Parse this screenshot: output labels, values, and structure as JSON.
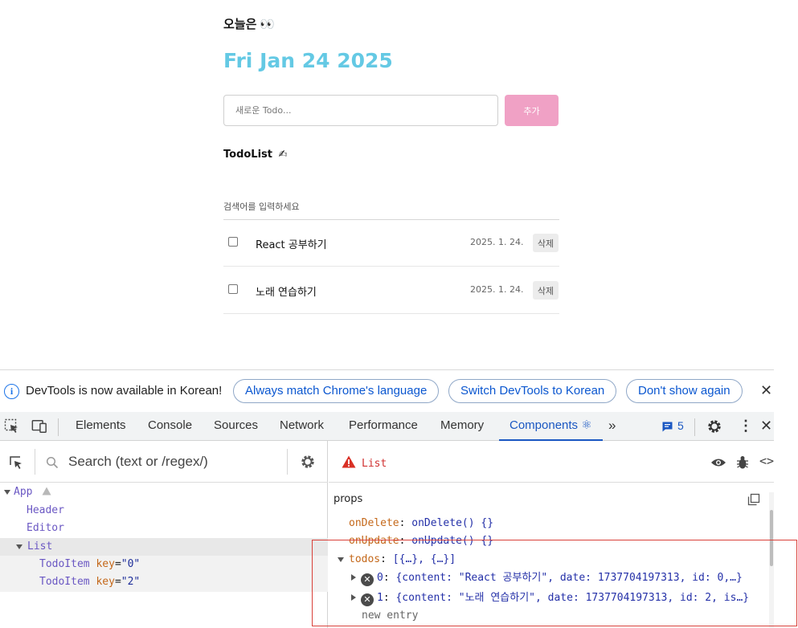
{
  "app": {
    "greeting": "오늘은",
    "greeting_emoji": "👀",
    "date": "Fri Jan 24 2025",
    "new_todo_placeholder": "새로운 Todo...",
    "add_label": "추가",
    "list_title": "TodoList",
    "list_title_emoji": "✍",
    "search_placeholder": "검색어를 입력하세요",
    "todos": [
      {
        "content": "React 공부하기",
        "date": "2025. 1. 24.",
        "delete_label": "삭제"
      },
      {
        "content": "노래 연습하기",
        "date": "2025. 1. 24.",
        "delete_label": "삭제"
      }
    ]
  },
  "devtools": {
    "infobar": {
      "message": "DevTools is now available in Korean!",
      "btn_match": "Always match Chrome's language",
      "btn_switch": "Switch DevTools to Korean",
      "btn_dont_show": "Don't show again"
    },
    "tabs": [
      "Elements",
      "Console",
      "Sources",
      "Network",
      "Performance",
      "Memory",
      "Components ⚛"
    ],
    "active_tab": "Components ⚛",
    "issues_count": "5",
    "search_placeholder": "Search (text or /regex/)",
    "tree": [
      {
        "name": "App"
      },
      {
        "name": "Header"
      },
      {
        "name": "Editor"
      },
      {
        "name": "List"
      },
      {
        "name": "TodoItem",
        "key_label": "key",
        "key_value": "\"0\""
      },
      {
        "name": "TodoItem",
        "key_label": "key",
        "key_value": "\"2\""
      }
    ],
    "selected_component": "List",
    "props_label": "props",
    "props": {
      "on_delete_key": "onDelete",
      "on_delete_val": "onDelete() {}",
      "on_update_key": "onUpdate",
      "on_update_val": "onUpdate() {}",
      "todos_key": "todos",
      "todos_val": "[{…}, {…}]",
      "item0_key": "0",
      "item0_val": "{content: \"React 공부하기\", date: 1737704197313, id: 0,…}",
      "item1_key": "1",
      "item1_val": "{content: \"노래 연습하기\", date: 1737704197313, id: 2, is…}",
      "new_entry": "new entry"
    }
  },
  "colors": {
    "date_accent": "#64c9e4",
    "add_button": "#f0a1c5",
    "devtools_active": "#1a57c2",
    "highlight_box": "#d9413a"
  }
}
